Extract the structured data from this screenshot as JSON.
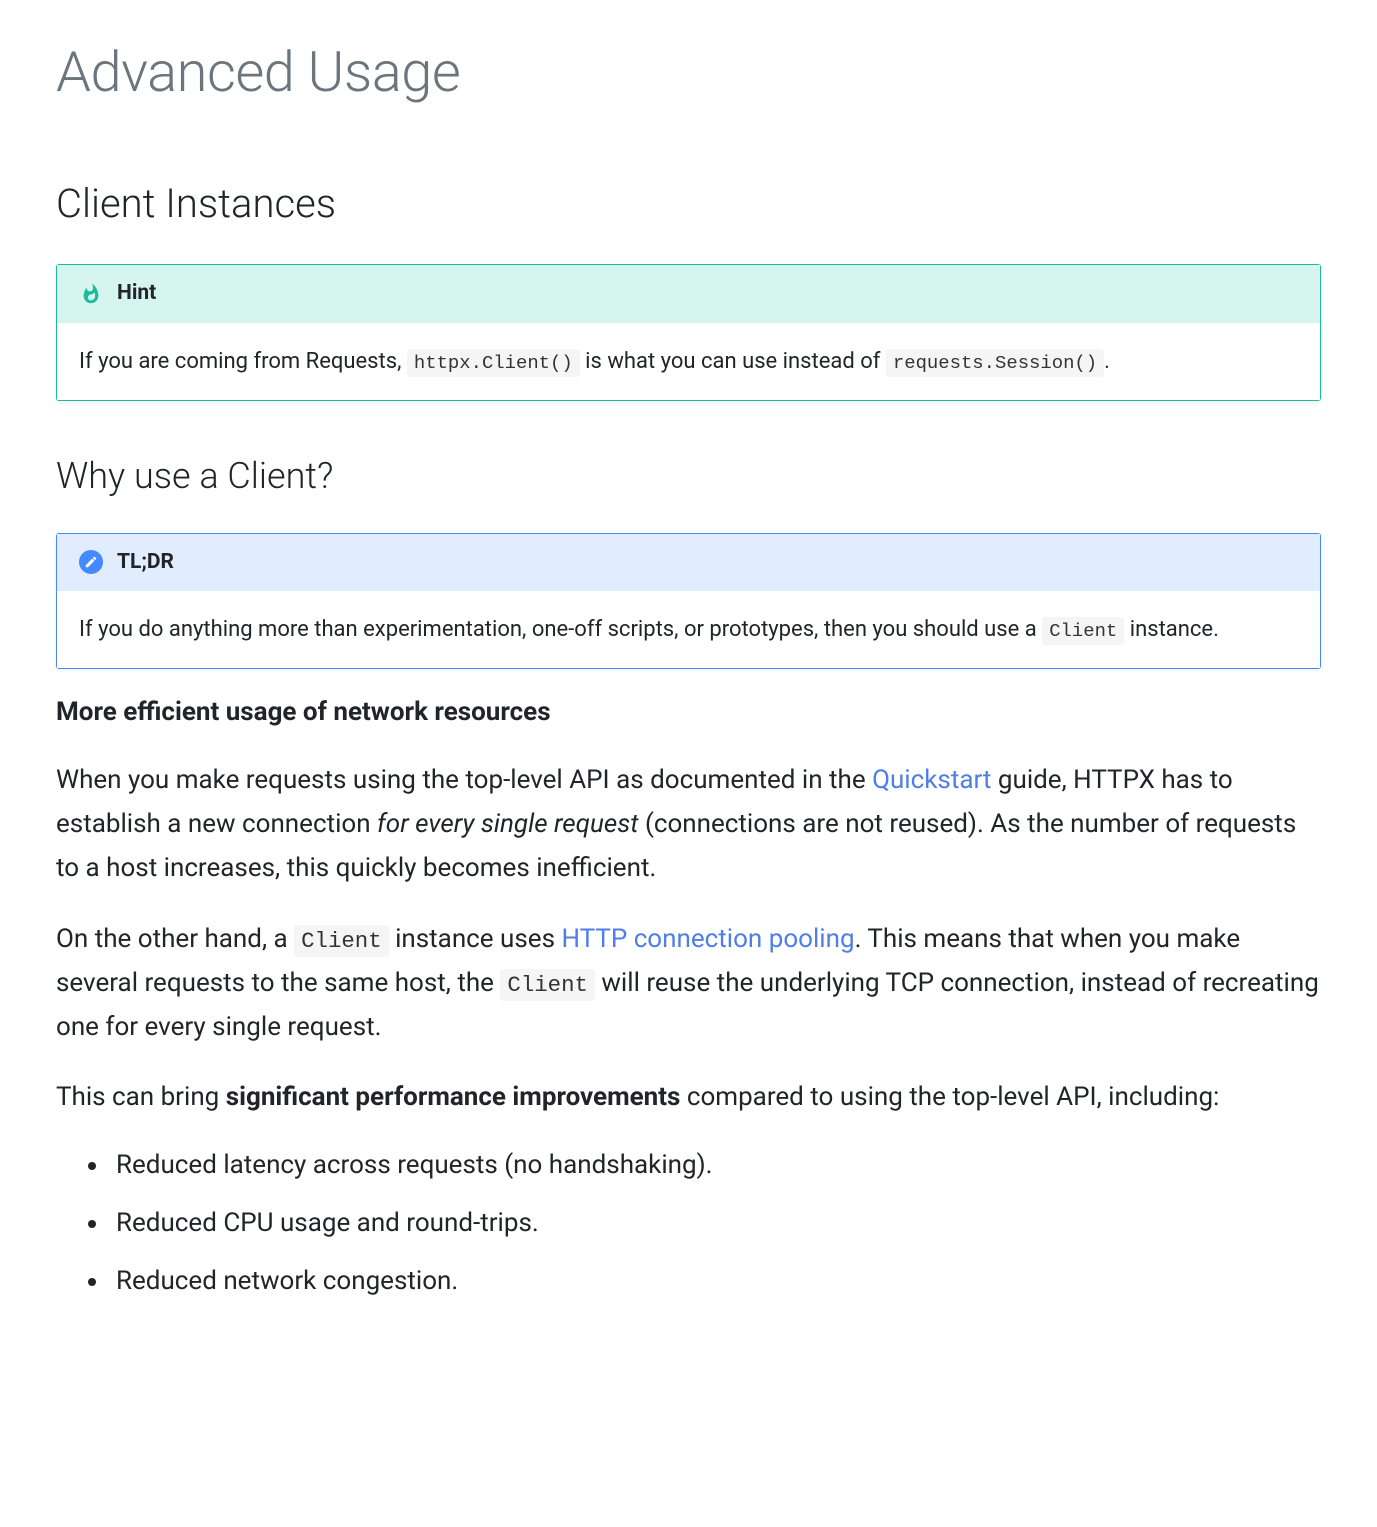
{
  "page": {
    "title": "Advanced Usage",
    "section_title": "Client Instances",
    "hint": {
      "label": "Hint",
      "text_before": "If you are coming from Requests, ",
      "code_1": "httpx.Client()",
      "text_middle": " is what you can use instead of ",
      "code_2": "requests.Session()",
      "text_after": "."
    },
    "why": {
      "title": "Why use a Client?",
      "tldr_label": "TL;DR",
      "tldr_text_before": "If you do anything more than experimentation, one-off scripts, or prototypes, then you should use a ",
      "tldr_code": "Client",
      "tldr_text_after": " instance."
    },
    "efficiency": {
      "heading": "More efficient usage of network resources",
      "p1_a": "When you make requests using the top-level API as documented in the ",
      "p1_link1": "Quickstart",
      "p1_b": " guide, HTTPX has to establish a new connection ",
      "p1_em": "for every single request",
      "p1_c": " (connections are not reused). As the number of requests to a host increases, this quickly becomes inefficient.",
      "p2_a": "On the other hand, a ",
      "p2_code1": "Client",
      "p2_b": " instance uses ",
      "p2_link": "HTTP connection pooling",
      "p2_c": ". This means that when you make several requests to the same host, the ",
      "p2_code2": "Client",
      "p2_d": " will reuse the underlying TCP connection, instead of recreating one for every single request.",
      "p3_a": "This can bring ",
      "p3_strong": "significant performance improvements",
      "p3_b": " compared to using the top-level API, including:",
      "bullets": [
        "Reduced latency across requests (no handshaking).",
        "Reduced CPU usage and round-trips.",
        "Reduced network congestion."
      ]
    }
  }
}
